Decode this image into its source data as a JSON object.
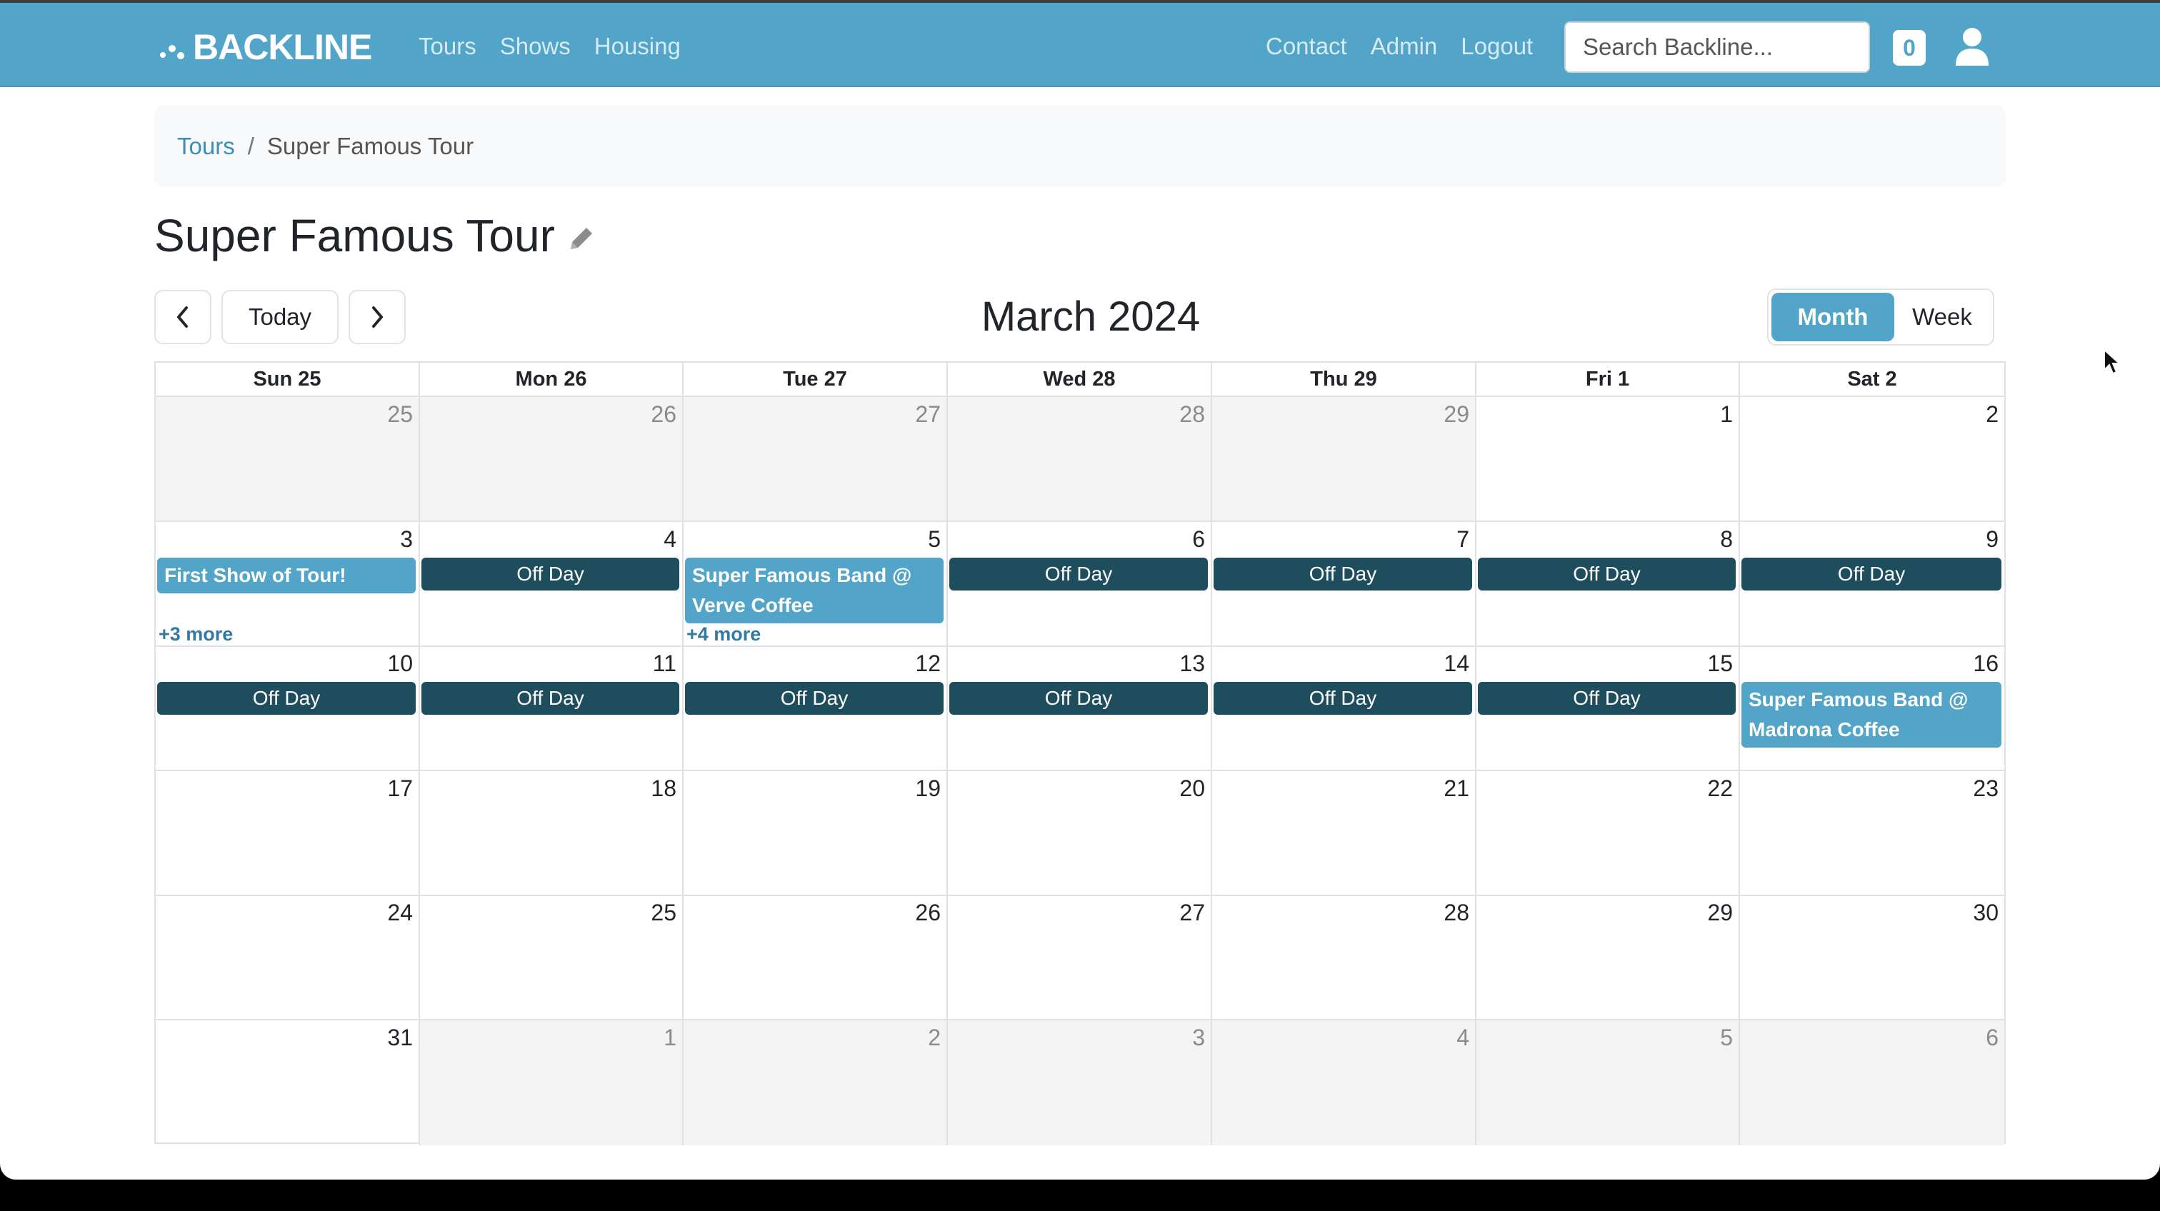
{
  "nav": {
    "brand": "BACKLINE",
    "left_links": [
      "Tours",
      "Shows",
      "Housing"
    ],
    "right_links": [
      "Contact",
      "Admin",
      "Logout"
    ],
    "search_placeholder": "Search Backline...",
    "badge_count": "0"
  },
  "breadcrumb": {
    "root": "Tours",
    "sep": "/",
    "current": "Super Famous Tour"
  },
  "page": {
    "title": "Super Famous Tour"
  },
  "toolbar": {
    "today": "Today",
    "title": "March 2024",
    "month": "Month",
    "week": "Week"
  },
  "calendar": {
    "weekdays": [
      "Sun 25",
      "Mon 26",
      "Tue 27",
      "Wed 28",
      "Thu 29",
      "Fri 1",
      "Sat 2"
    ],
    "weeks": [
      [
        "25",
        "26",
        "27",
        "28",
        "29",
        "1",
        "2"
      ],
      [
        "3",
        "4",
        "5",
        "6",
        "7",
        "8",
        "9"
      ],
      [
        "10",
        "11",
        "12",
        "13",
        "14",
        "15",
        "16"
      ],
      [
        "17",
        "18",
        "19",
        "20",
        "21",
        "22",
        "23"
      ],
      [
        "24",
        "25",
        "26",
        "27",
        "28",
        "29",
        "30"
      ],
      [
        "31",
        "1",
        "2",
        "3",
        "4",
        "5",
        "6"
      ]
    ],
    "events": [
      {
        "week": 1,
        "day": 0,
        "type": "show",
        "label": "First Show of Tour!"
      },
      {
        "week": 1,
        "day": 1,
        "type": "off",
        "label": "Off Day"
      },
      {
        "week": 1,
        "day": 2,
        "type": "show",
        "label": "Super Famous Band @ Verve Coffee"
      },
      {
        "week": 1,
        "day": 3,
        "type": "off",
        "label": "Off Day"
      },
      {
        "week": 1,
        "day": 4,
        "type": "off",
        "label": "Off Day"
      },
      {
        "week": 1,
        "day": 5,
        "type": "off",
        "label": "Off Day"
      },
      {
        "week": 1,
        "day": 6,
        "type": "off",
        "label": "Off Day"
      },
      {
        "week": 2,
        "day": 0,
        "type": "off",
        "label": "Off Day"
      },
      {
        "week": 2,
        "day": 1,
        "type": "off",
        "label": "Off Day"
      },
      {
        "week": 2,
        "day": 2,
        "type": "off",
        "label": "Off Day"
      },
      {
        "week": 2,
        "day": 3,
        "type": "off",
        "label": "Off Day"
      },
      {
        "week": 2,
        "day": 4,
        "type": "off",
        "label": "Off Day"
      },
      {
        "week": 2,
        "day": 5,
        "type": "off",
        "label": "Off Day"
      },
      {
        "week": 2,
        "day": 6,
        "type": "show",
        "label": "Super Famous Band @ Madrona Coffee"
      }
    ],
    "more_links": [
      {
        "week": 1,
        "day": 0,
        "label": "+3 more"
      },
      {
        "week": 1,
        "day": 2,
        "label": "+4 more"
      }
    ]
  }
}
